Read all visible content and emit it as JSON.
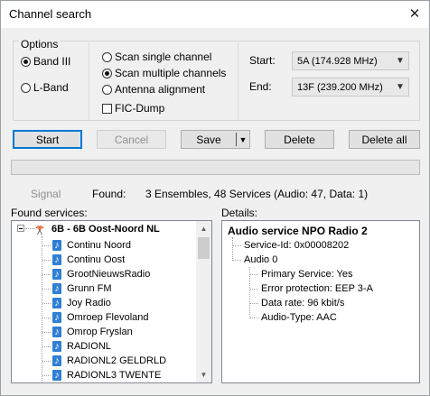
{
  "window": {
    "title": "Channel search"
  },
  "options": {
    "legend": "Options",
    "band_iii": "Band III",
    "l_band": "L-Band",
    "scan_single": "Scan single channel",
    "scan_multiple": "Scan multiple channels",
    "antenna_alignment": "Antenna alignment",
    "fic_dump": "FIC-Dump",
    "start_label": "Start:",
    "start_value": "5A (174.928 MHz)",
    "end_label": "End:",
    "end_value": "13F (239.200 MHz)"
  },
  "buttons": {
    "start": "Start",
    "cancel": "Cancel",
    "save": "Save",
    "delete": "Delete",
    "delete_all": "Delete all"
  },
  "status": {
    "signal_label": "Signal",
    "found_label": "Found:",
    "found_value": "3 Ensembles, 48 Services (Audio: 47, Data: 1)"
  },
  "found_services": {
    "label": "Found services:",
    "ensemble": "6B - 6B Oost-Noord NL",
    "items": [
      "Continu Noord",
      "Continu Oost",
      "GrootNieuwsRadio",
      "Grunn FM",
      "Joy Radio",
      "Omroep Flevoland",
      "Omrop Fryslan",
      "RADIONL",
      "RADIONL2 GELDRLD",
      "RADIONL3 TWENTE"
    ]
  },
  "details": {
    "label": "Details:",
    "header": "Audio service NPO Radio 2",
    "service_id": "Service-Id: 0x00008202",
    "audio": "Audio 0",
    "primary": "Primary Service: Yes",
    "error_protection": "Error protection: EEP 3-A",
    "data_rate": "Data rate: 96 kbit/s",
    "audio_type": "Audio-Type: AAC"
  },
  "icons": {
    "close": "close-icon",
    "service": "music-note-icon",
    "ensemble": "antenna-icon"
  },
  "colors": {
    "accent": "#0078d7",
    "note": "#2f7fd5"
  }
}
